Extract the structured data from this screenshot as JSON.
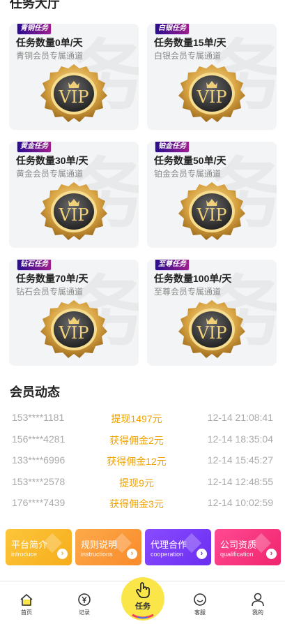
{
  "hall": {
    "title": "任务大厅",
    "cards": [
      {
        "badge": "青铜任务",
        "count": "任务数量0单/天",
        "sub": "青铜会员专属通道",
        "seal_text": "VIP"
      },
      {
        "badge": "白银任务",
        "count": "任务数量15单/天",
        "sub": "白银会员专属通道",
        "seal_text": "VIP"
      },
      {
        "badge": "黄金任务",
        "count": "任务数量30单/天",
        "sub": "黄金会员专属通道",
        "seal_text": "VIP"
      },
      {
        "badge": "铂金任务",
        "count": "任务数量50单/天",
        "sub": "铂金会员专属通道",
        "seal_text": "VIP"
      },
      {
        "badge": "钻石任务",
        "count": "任务数量70单/天",
        "sub": "钻石会员专属通道",
        "seal_text": "VIP"
      },
      {
        "badge": "至尊任务",
        "count": "任务数量100单/天",
        "sub": "至尊会员专属通道",
        "seal_text": "VIP"
      }
    ]
  },
  "news": {
    "title": "会员动态",
    "rows": [
      {
        "phone": "153****1181",
        "action": "提现1497元",
        "time": "12-14 21:08:41"
      },
      {
        "phone": "156****4281",
        "action": "获得佣金2元",
        "time": "12-14 18:35:04"
      },
      {
        "phone": "133****6996",
        "action": "获得佣金12元",
        "time": "12-14 15:45:27"
      },
      {
        "phone": "153****2578",
        "action": "提现9元",
        "time": "12-14 12:48:55"
      },
      {
        "phone": "176****7439",
        "action": "获得佣金3元",
        "time": "12-14 10:02:59"
      }
    ]
  },
  "quick": [
    {
      "title": "平台简介",
      "sub": "introduce",
      "color": "#f9bd2b"
    },
    {
      "title": "规则说明",
      "sub": "instructions",
      "color": "#fb9a3a"
    },
    {
      "title": "代理合作",
      "sub": "cooperation",
      "color": "#7a3cf7"
    },
    {
      "title": "公司资质",
      "sub": "qualification",
      "color": "#f7317f"
    }
  ],
  "tabbar": {
    "home": "首页",
    "records": "记录",
    "task": "任务",
    "service": "客服",
    "mine": "我的"
  }
}
